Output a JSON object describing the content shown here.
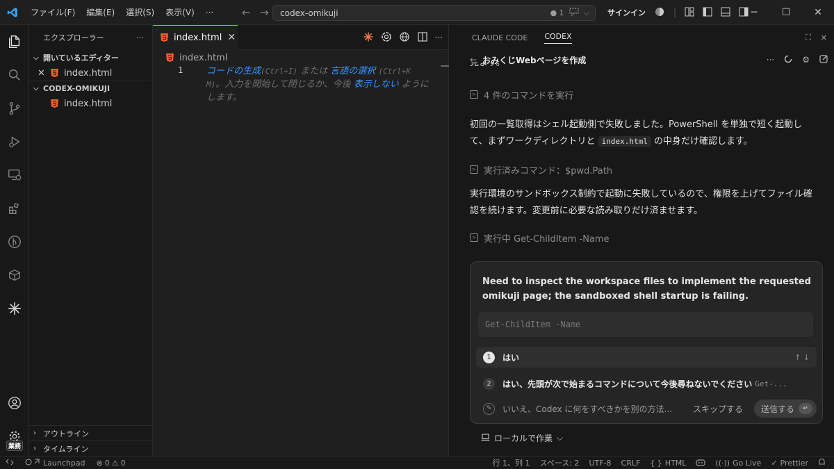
{
  "titlebar": {
    "menu": [
      "ファイル(F)",
      "編集(E)",
      "選択(S)",
      "表示(V)",
      "···"
    ],
    "search_text": "codex-omikuji",
    "search_count": "● 1",
    "signin": "サインイン"
  },
  "activity": {
    "badge": "業務"
  },
  "sidebar": {
    "title": "エクスプローラー",
    "more": "···",
    "open_editors": "開いているエディター",
    "open_file": "index.html",
    "project": "CODEX-OMIKUJI",
    "project_file": "index.html",
    "outline": "アウトライン",
    "timeline": "タイムライン"
  },
  "editor": {
    "tab_label": "index.html",
    "breadcrumb": "index.html",
    "line_number": "1",
    "hint": {
      "generate": "コードの生成",
      "generate_key": "(Ctrl+I)",
      "or": "または",
      "select_lang": "言語の選択",
      "select_key": "(Ctrl+K M)",
      "rest": "。入力を開始して閉じるか、今後",
      "dont_show": "表示しない",
      "tail": "ようにします。"
    }
  },
  "panel": {
    "tabs": [
      "CLAUDE CODE",
      "CODEX"
    ],
    "title": "おみくじWebページを作成",
    "top_fragment": "見ます。",
    "cmd1": "4 件のコマンドを実行",
    "para1_a": "初回の一覧取得はシェル起動側で失敗しました。PowerShell を単独で短く起動して、まずワークディレクトリと",
    "para1_code": "index.html",
    "para1_b": "の中身だけ確認します。",
    "cmd2": "実行済みコマンド：$pwd.Path",
    "para2": "実行環境のサンドボックス制約で起動に失敗しているので、権限を上げてファイル確認を続けます。変更前に必要な読み取りだけ済ませます。",
    "cmd3": "実行中 Get-ChildItem -Name",
    "card": {
      "question": "Need to inspect the workspace files to implement the requested omikuji page; the sandboxed shell startup is failing.",
      "command": "Get-ChildItem -Name",
      "options": [
        {
          "num": "1",
          "label": "はい",
          "extra": ""
        },
        {
          "num": "2",
          "label": "はい、先頭が次で始まるコマンドについて今後尋ねないでください",
          "extra": "Get-..."
        }
      ],
      "other_placeholder": "いいえ、Codex に何をすべきかを別の方法...",
      "skip": "スキップする",
      "send": "送信する"
    },
    "local": "ローカルで作業"
  },
  "statusbar": {
    "launchpad": "Launchpad",
    "errors": "0",
    "warnings": "0",
    "position": "行 1、列 1",
    "spaces": "スペース: 2",
    "encoding": "UTF-8",
    "eol": "CRLF",
    "language": "HTML",
    "golive": "Go Live",
    "prettier": "Prettier"
  },
  "colors": {
    "accent": "#3794ff",
    "html_icon": "#e8612c",
    "tab_border": "#f9826c"
  }
}
